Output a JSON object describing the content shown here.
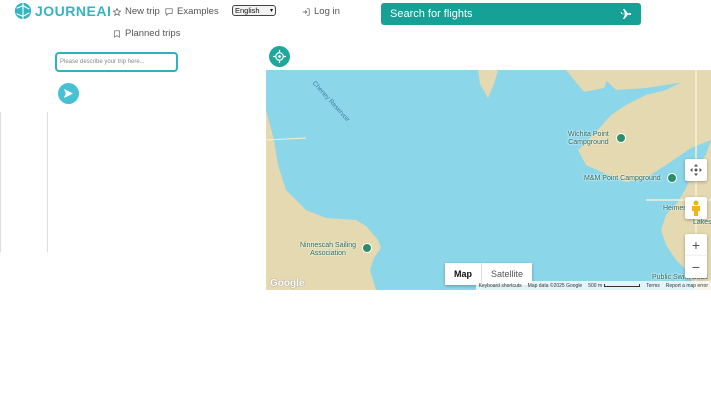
{
  "header": {
    "logo_text": "JOURNEAI",
    "nav": {
      "new_trip": "New trip",
      "examples": "Examples",
      "planned_trips": "Planned trips",
      "login": "Log in"
    },
    "language": {
      "selected": "English"
    },
    "flight_search": {
      "label": "Search for flights",
      "icon": "airplane-icon"
    }
  },
  "trip_panel": {
    "input_placeholder": "Please describe your trip here...",
    "send_icon": "send-icon"
  },
  "map": {
    "water_label": "Cheney Reservoir",
    "pois": [
      {
        "name_line1": "Wichita Point",
        "name_line2": "Campground"
      },
      {
        "name_line1": "M&M Point Campground",
        "name_line2": ""
      },
      {
        "name_line1": "Ninnescah Sailing",
        "name_line2": "Association"
      },
      {
        "name_line1": "Heimer",
        "name_line2": "Lakes"
      },
      {
        "name_line1": "Public Swim Beac",
        "name_line2": ""
      }
    ],
    "map_type": {
      "map": "Map",
      "satellite": "Satellite"
    },
    "footer": {
      "shortcuts": "Keyboard shortcuts",
      "map_data": "Map data ©2025 Google",
      "scale": "500 m",
      "terms": "Terms",
      "report": "Report a map error"
    },
    "google_logo": "Google",
    "colors": {
      "water": "#8cd6ea",
      "land": "#e4d9b0",
      "accent": "#17a095"
    }
  }
}
